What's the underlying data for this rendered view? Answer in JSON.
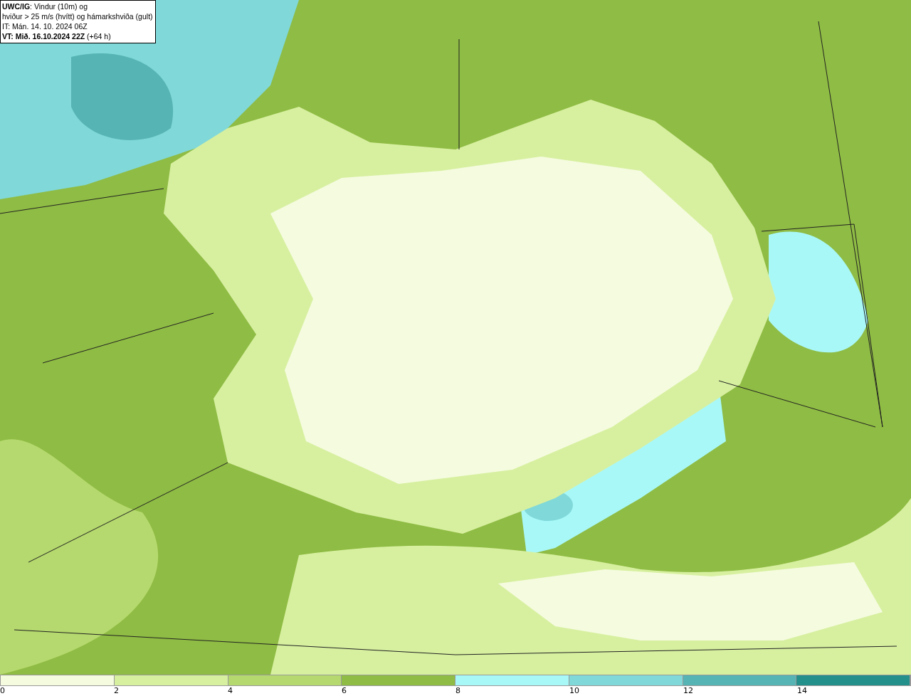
{
  "legend": {
    "lines": [
      "**UWC/IG**: Vindur (10m) og",
      "hviður > 25 m/s (hvítt) og hámarkshviða (gult)",
      "IT: Mán. 14. 10. 2024 06Z",
      "**VT: Mið. 16.10.2024 22Z** (+64 h)"
    ]
  },
  "colorbar": {
    "segments": [
      {
        "color": "#f5fbdf",
        "label": "0"
      },
      {
        "color": "#d7f0a0",
        "label": "2"
      },
      {
        "color": "#b5d96e",
        "label": "4"
      },
      {
        "color": "#8fbc44",
        "label": "6"
      },
      {
        "color": "#a8f8f8",
        "label": "8"
      },
      {
        "color": "#80d8d8",
        "label": "10"
      },
      {
        "color": "#56b4b4",
        "label": "12"
      },
      {
        "color": "#23908c",
        "label": "14"
      }
    ]
  }
}
